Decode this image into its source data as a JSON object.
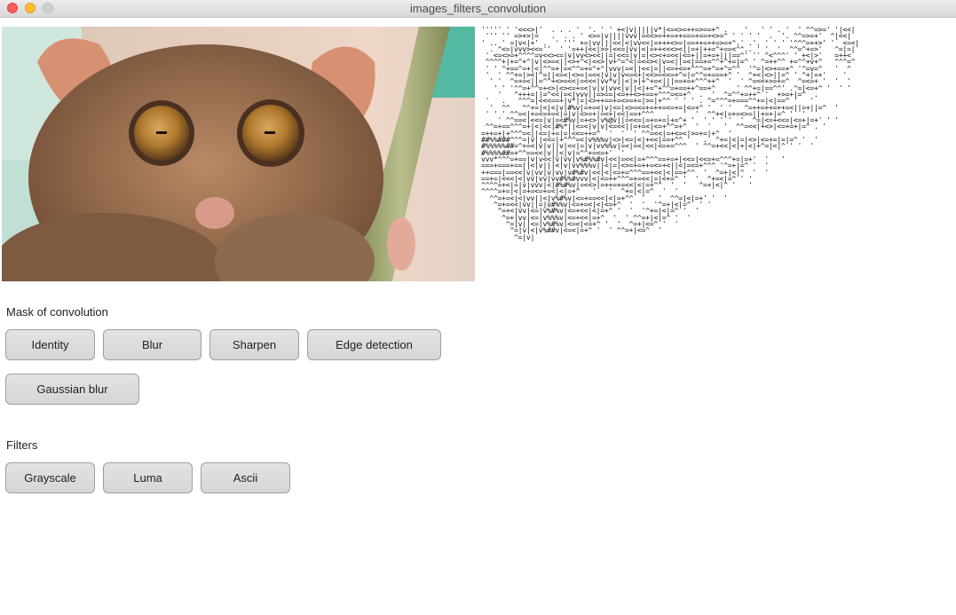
{
  "window": {
    "title": "images_filters_convolution"
  },
  "convolution": {
    "label": "Mask of convolution",
    "buttons": [
      "Identity",
      "Blur",
      "Sharpen",
      "Edge detection",
      "Gaussian blur"
    ]
  },
  "filters": {
    "label": "Filters",
    "buttons": [
      "Grayscale",
      "Luma",
      "Ascii"
    ]
  },
  "colors": {
    "titlebar": "#dcdcdc",
    "button_bg": "#d9d9d9",
    "button_border": "#9e9e9e",
    "fur": "#9a7050",
    "iris": "#b58232"
  }
}
